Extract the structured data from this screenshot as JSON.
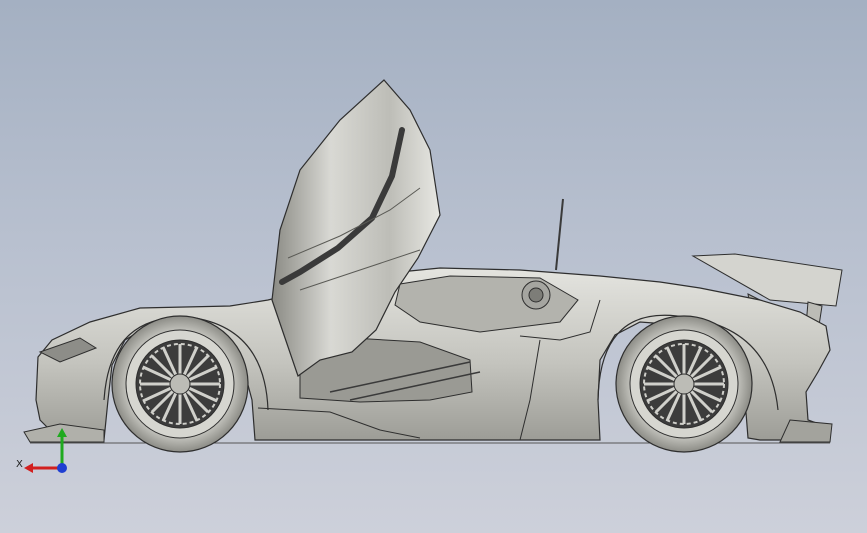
{
  "viewport": {
    "background_top": "#a4b0c2",
    "background_bottom": "#cdd0da"
  },
  "model": {
    "name": "sports-car-side-view",
    "body_color": "#c9c9c4",
    "edge_color": "#2e2e2e"
  },
  "triad": {
    "x_label": "X",
    "x_color": "#d21f1f",
    "y_color": "#1faa1f",
    "z_color": "#1f3fd2"
  }
}
